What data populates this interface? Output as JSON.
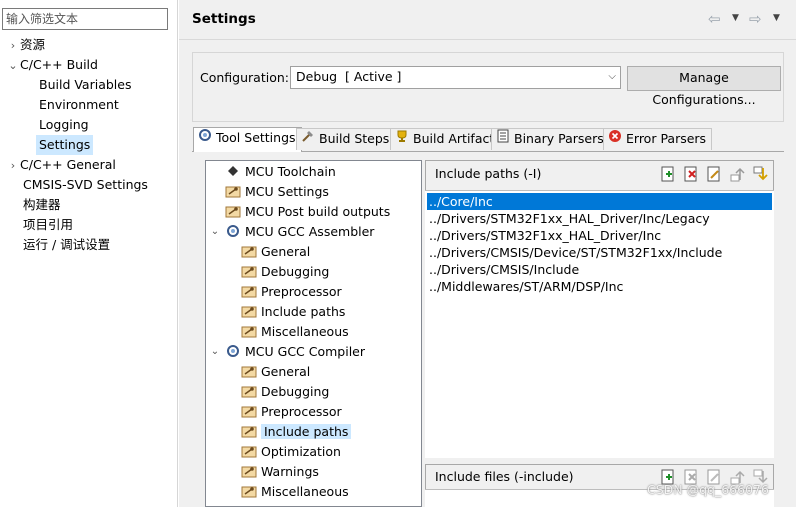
{
  "filter": {
    "placeholder": "输入筛选文本"
  },
  "nav": {
    "items": [
      {
        "label": "资源",
        "expandable": true
      },
      {
        "label": "C/C++ Build",
        "expanded": true
      },
      {
        "label": "Build Variables"
      },
      {
        "label": "Environment"
      },
      {
        "label": "Logging"
      },
      {
        "label": "Settings",
        "selected": true
      },
      {
        "label": "C/C++ General",
        "expandable": true
      },
      {
        "label": "CMSIS-SVD Settings"
      },
      {
        "label": "构建器"
      },
      {
        "label": "项目引用"
      },
      {
        "label": "运行 / 调试设置"
      }
    ]
  },
  "header": {
    "title": "Settings"
  },
  "config": {
    "label": "Configuration:",
    "selected": "Debug  [ Active ]",
    "manage_label": "Manage Configurations..."
  },
  "tabs": [
    {
      "label": "Tool Settings",
      "active": true,
      "icon": "tool-settings-icon"
    },
    {
      "label": "Build Steps",
      "icon": "build-steps-icon"
    },
    {
      "label": "Build Artifact",
      "icon": "trophy-icon"
    },
    {
      "label": "Binary Parsers",
      "icon": "binary-parsers-icon"
    },
    {
      "label": "Error Parsers",
      "icon": "error-icon"
    }
  ],
  "tree": {
    "items": [
      {
        "label": "MCU Toolchain"
      },
      {
        "label": "MCU Settings"
      },
      {
        "label": "MCU Post build outputs"
      },
      {
        "label": "MCU GCC Assembler",
        "expanded": true
      },
      {
        "label": "General"
      },
      {
        "label": "Debugging"
      },
      {
        "label": "Preprocessor"
      },
      {
        "label": "Include paths"
      },
      {
        "label": "Miscellaneous"
      },
      {
        "label": "MCU GCC Compiler",
        "expanded": true
      },
      {
        "label": "General"
      },
      {
        "label": "Debugging"
      },
      {
        "label": "Preprocessor"
      },
      {
        "label": "Include paths",
        "selected": true
      },
      {
        "label": "Optimization"
      },
      {
        "label": "Warnings"
      },
      {
        "label": "Miscellaneous"
      }
    ]
  },
  "include_paths": {
    "title": "Include paths (-I)",
    "items": [
      "../Core/Inc",
      "../Drivers/STM32F1xx_HAL_Driver/Inc/Legacy",
      "../Drivers/STM32F1xx_HAL_Driver/Inc",
      "../Drivers/CMSIS/Device/ST/STM32F1xx/Include",
      "../Drivers/CMSIS/Include",
      "../Middlewares/ST/ARM/DSP/Inc"
    ],
    "selected_index": 0
  },
  "include_files": {
    "title": "Include files (-include)"
  },
  "watermark": "CSDN @qq_666076",
  "colors": {
    "selection": "#0078d7",
    "nav_selection": "#cce8ff",
    "pane_bg": "#f0f0f0"
  }
}
